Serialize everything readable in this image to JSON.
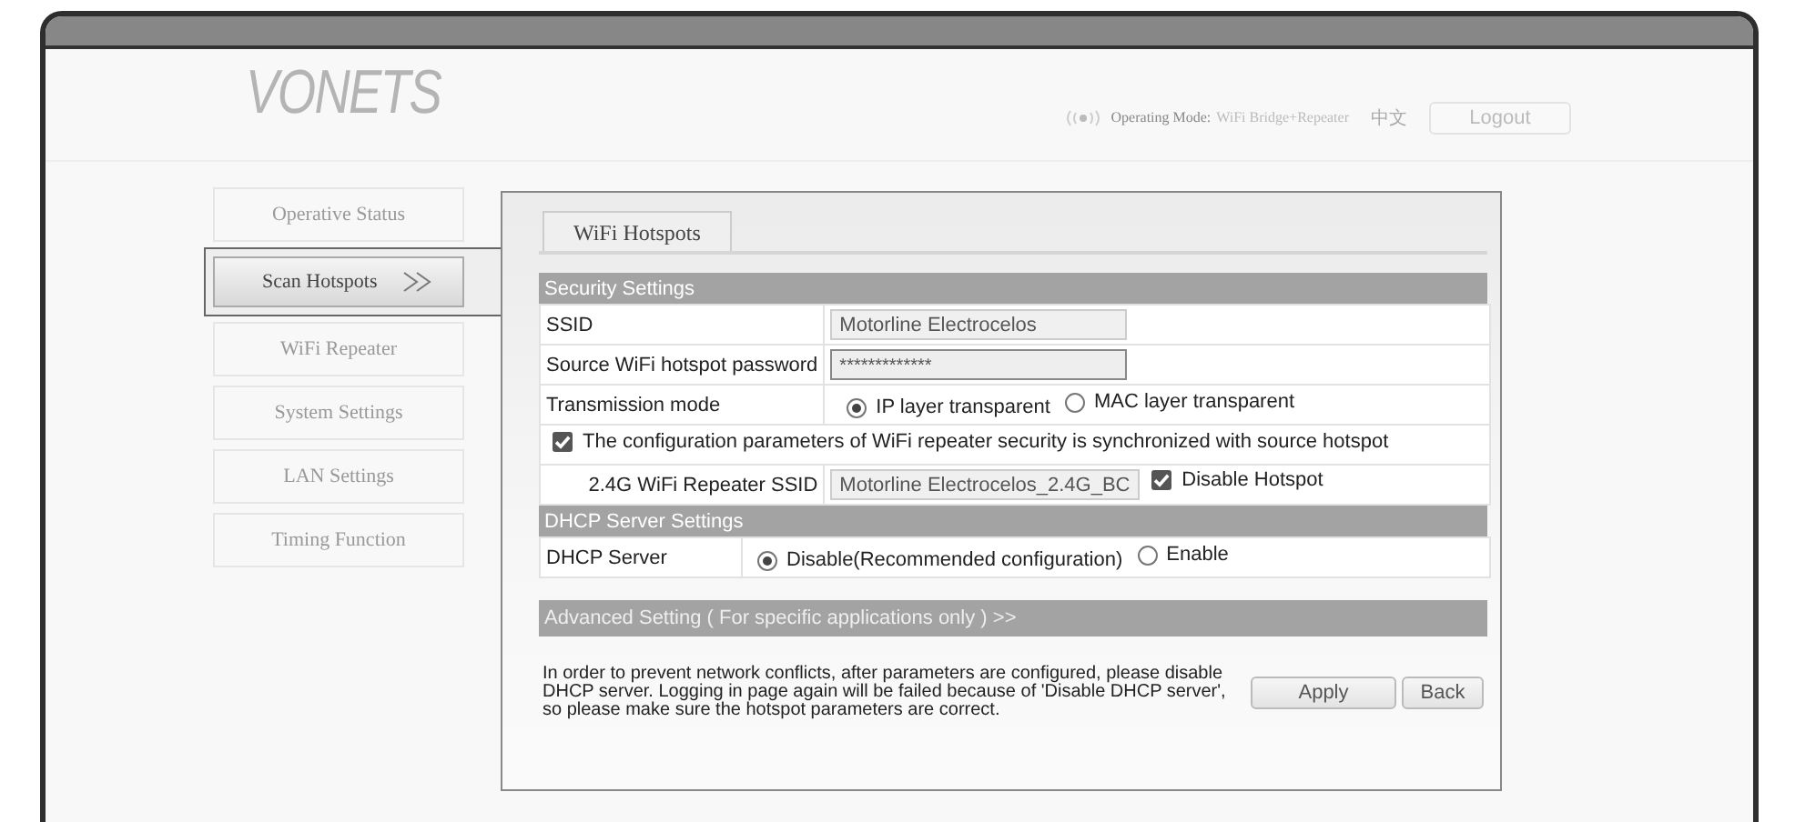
{
  "header": {
    "logo": "VONETS",
    "mode_label": "Operating Mode:",
    "mode_value": "WiFi Bridge+Repeater",
    "language": "中文",
    "logout": "Logout"
  },
  "sidebar": {
    "items": [
      {
        "label": "Operative Status",
        "selected": false
      },
      {
        "label": "Scan Hotspots",
        "selected": true
      },
      {
        "label": "WiFi Repeater",
        "selected": false
      },
      {
        "label": "System Settings",
        "selected": false
      },
      {
        "label": "LAN Settings",
        "selected": false
      },
      {
        "label": "Timing Function",
        "selected": false
      }
    ]
  },
  "tabs": [
    {
      "label": "WiFi Hotspots",
      "selected": true
    }
  ],
  "security": {
    "title": "Security Settings",
    "rows": [
      {
        "kind": "text",
        "label": "SSID",
        "value": "Motorline Electrocelos"
      },
      {
        "kind": "password",
        "label": "Source WiFi hotspot password",
        "value": "*************"
      },
      {
        "kind": "radio",
        "label": "Transmission mode",
        "options": [
          {
            "label": "IP layer transparent",
            "selected": true
          },
          {
            "label": "MAC layer transparent",
            "selected": false
          }
        ]
      },
      {
        "kind": "checkbox",
        "label": "The configuration parameters of WiFi repeater security is synchronized with source hotspot",
        "checked": true
      },
      {
        "kind": "ssid",
        "label": "2.4G WiFi Repeater SSID",
        "value": "Motorline Electrocelos_2.4G_BC",
        "option": {
          "label": "Disable Hotspot",
          "checked": true
        }
      }
    ]
  },
  "dhcp": {
    "title": "DHCP Server Settings",
    "label": "DHCP Server",
    "options": [
      {
        "label": "Disable(Recommended configuration)",
        "selected": true
      },
      {
        "label": "Enable",
        "selected": false
      }
    ]
  },
  "advanced": "Advanced Setting ( For specific applications only ) >>",
  "note": "In order to prevent network conflicts, after parameters are configured, please disable DHCP server. Logging in page again will be failed because of 'Disable DHCP server', so please make sure the hotspot parameters are correct.",
  "buttons": [
    "Apply",
    "Back"
  ]
}
